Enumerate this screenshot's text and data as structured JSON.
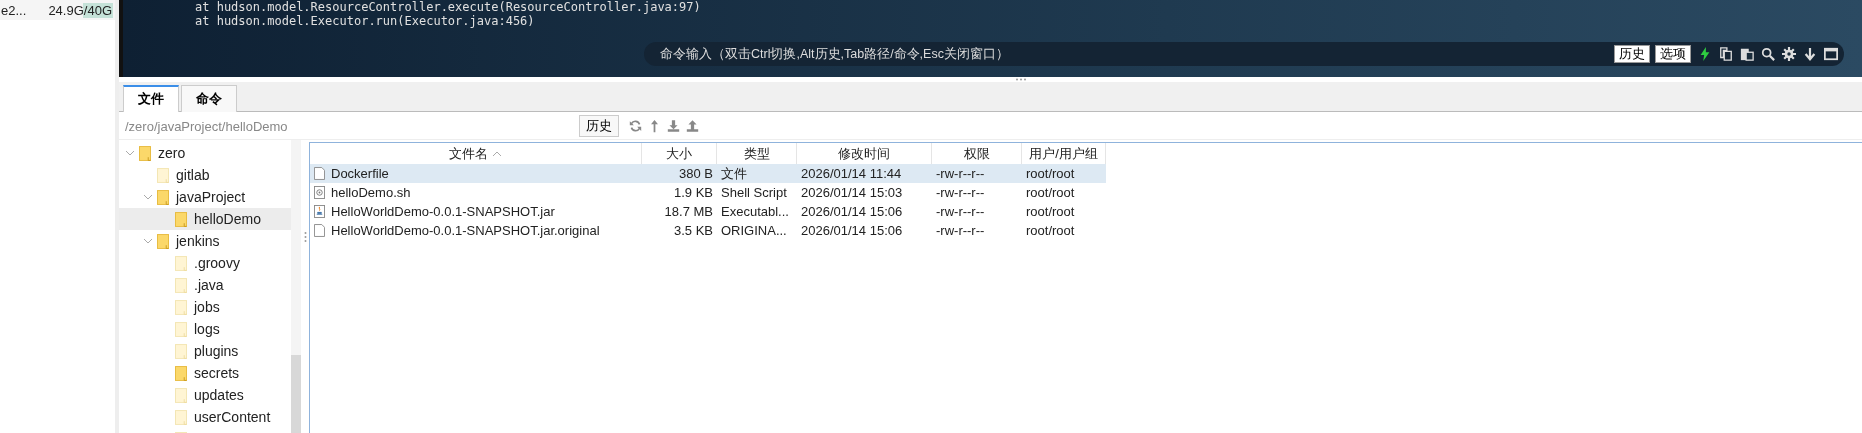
{
  "sidebar": {
    "host": "e2...",
    "disk": {
      "reading": "24.9G/40G",
      "level": 0.45
    }
  },
  "terminal": {
    "lines": [
      "at hudson.model.ResourceController.execute(ResourceController.java:97)",
      "at hudson.model.Executor.run(Executor.java:456)"
    ],
    "command_bar": {
      "placeholder": "命令输入（双击Ctrl切换,Alt历史,Tab路径/命令,Esc关闭窗口）",
      "buttons": [
        "历史",
        "选项"
      ]
    }
  },
  "tabs": [
    {
      "label": "文件",
      "selected": true
    },
    {
      "label": "命令",
      "selected": false
    }
  ],
  "path_bar": {
    "path": "/zero/javaProject/helloDemo",
    "history_button": "历史"
  },
  "tree": [
    {
      "name": "zero",
      "kind": "folder",
      "expanded": true,
      "selected": false,
      "children": [
        {
          "name": "gitlab",
          "kind": "empty-folder",
          "selected": false
        },
        {
          "name": "javaProject",
          "kind": "folder",
          "expanded": true,
          "selected": false,
          "children": [
            {
              "name": "helloDemo",
              "kind": "folder",
              "selected": true
            }
          ]
        },
        {
          "name": "jenkins",
          "kind": "folder",
          "expanded": true,
          "selected": false,
          "children": [
            {
              "name": ".groovy",
              "kind": "empty-folder",
              "selected": false
            },
            {
              "name": ".java",
              "kind": "empty-folder",
              "selected": false
            },
            {
              "name": "jobs",
              "kind": "empty-folder",
              "selected": false
            },
            {
              "name": "logs",
              "kind": "empty-folder",
              "selected": false
            },
            {
              "name": "plugins",
              "kind": "empty-folder",
              "selected": false
            },
            {
              "name": "secrets",
              "kind": "folder",
              "selected": false
            },
            {
              "name": "updates",
              "kind": "empty-folder",
              "selected": false
            },
            {
              "name": "userContent",
              "kind": "empty-folder",
              "selected": false
            },
            {
              "kind": "empty-folder",
              "selected": false
            }
          ]
        }
      ]
    }
  ],
  "table": {
    "columns": [
      "文件名",
      "大小",
      "类型",
      "修改时间",
      "权限",
      "用户/用户组"
    ],
    "rows": [
      {
        "kind": "file",
        "selected": true,
        "cells": [
          "Dockerfile",
          "380 B",
          "文件",
          "2026/01/14 11:44",
          "-rw-r--r--",
          "root/root"
        ]
      },
      {
        "kind": "script",
        "selected": false,
        "cells": [
          "helloDemo.sh",
          "1.9 KB",
          "Shell Script",
          "2026/01/14 15:03",
          "-rw-r--r--",
          "root/root"
        ]
      },
      {
        "kind": "jar",
        "selected": false,
        "cells": [
          "HelloWorldDemo-0.0.1-SNAPSHOT.jar",
          "18.7 MB",
          "Executabl...",
          "2026/01/14 15:06",
          "-rw-r--r--",
          "root/root"
        ]
      },
      {
        "kind": "file",
        "selected": false,
        "cells": [
          "HelloWorldDemo-0.0.1-SNAPSHOT.jar.original",
          "3.5 KB",
          "ORIGINA...",
          "2026/01/14 15:06",
          "-rw-r--r--",
          "root/root"
        ]
      }
    ]
  }
}
